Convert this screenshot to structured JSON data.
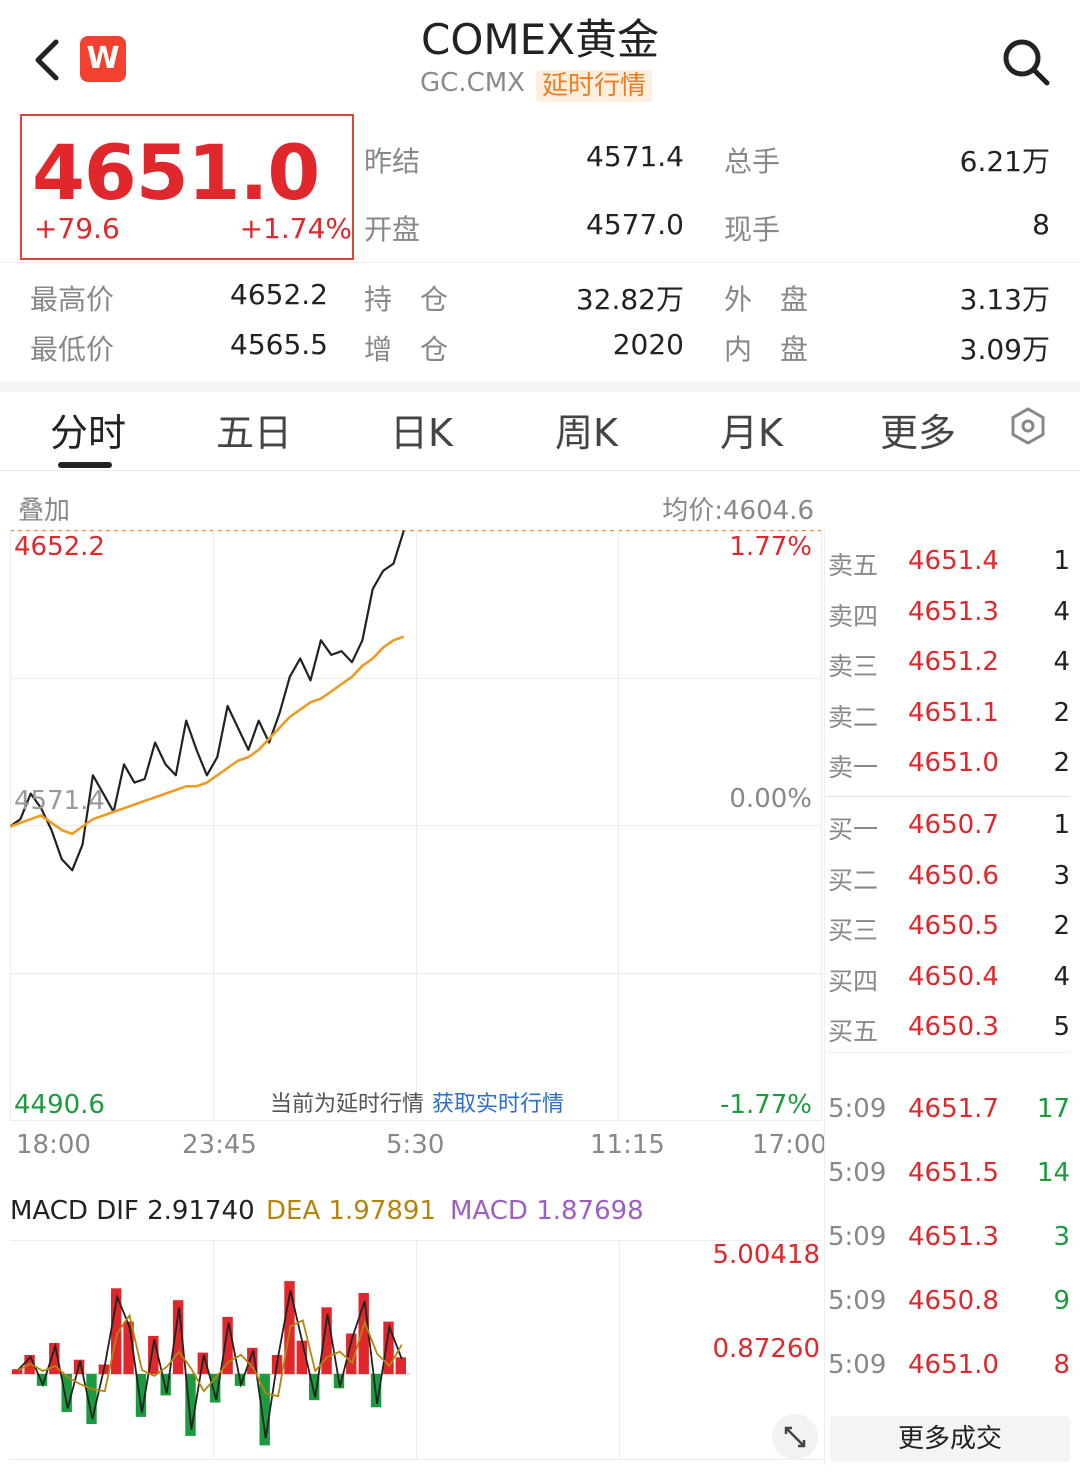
{
  "header": {
    "brand_letter": "W",
    "title": "COMEX黄金",
    "symbol": "GC.CMX",
    "delay_tag": "延时行情"
  },
  "quote": {
    "price": "4651.0",
    "change": "+79.6",
    "change_pct": "+1.74%",
    "rows": [
      [
        {
          "label": "昨结",
          "value": "4571.4"
        },
        {
          "label": "总手",
          "value": "6.21万"
        }
      ],
      [
        {
          "label": "开盘",
          "value": "4577.0"
        },
        {
          "label": "现手",
          "value": "8"
        }
      ],
      [
        {
          "label": "最高价",
          "value": "4652.2"
        },
        {
          "label": "持　仓",
          "value": "32.82万"
        },
        {
          "label": "外　盘",
          "value": "3.13万"
        }
      ],
      [
        {
          "label": "最低价",
          "value": "4565.5"
        },
        {
          "label": "增　仓",
          "value": "2020"
        },
        {
          "label": "内　盘",
          "value": "3.09万"
        }
      ]
    ]
  },
  "tabs": [
    "分时",
    "五日",
    "日K",
    "周K",
    "月K",
    "更多"
  ],
  "chart_header": {
    "overlay": "叠加",
    "avg_price": "均价:4604.6"
  },
  "chart_notice": {
    "text": "当前为延时行情",
    "link": "获取实时行情"
  },
  "chart_data": {
    "type": "line",
    "high_label": "4652.2",
    "mid_label": "4571.4",
    "low_label": "4490.6",
    "pct_high": "1.77%",
    "pct_mid": "0.00%",
    "pct_low": "-1.77%",
    "time_labels": [
      "18:00",
      "23:45",
      "5:30",
      "11:15",
      "17:00"
    ],
    "ylim": [
      4490.6,
      4652.2
    ],
    "series": [
      {
        "values": [
          4571,
          4573,
          4580,
          4576,
          4570,
          4562,
          4559,
          4566,
          4585,
          4580,
          4575,
          4588,
          4583,
          4584,
          4594,
          4588,
          4585,
          4600,
          4592,
          4585,
          4590,
          4604,
          4598,
          4592,
          4600,
          4594,
          4602,
          4612,
          4617,
          4611,
          4622,
          4618,
          4619,
          4616,
          4622,
          4636,
          4641,
          4643,
          4652
        ]
      },
      {
        "values": [
          4571,
          4572,
          4573,
          4574,
          4572,
          4570,
          4569,
          4571,
          4573,
          4574,
          4575,
          4576,
          4577,
          4578,
          4579,
          4580,
          4581,
          4582,
          4582,
          4583,
          4585,
          4587,
          4589,
          4590,
          4592,
          4595,
          4598,
          4601,
          4603,
          4605,
          4606,
          4608,
          4610,
          4612,
          4615,
          4617,
          4620,
          4622,
          4623
        ]
      }
    ]
  },
  "macd": {
    "dif_label": "MACD DIF 2.91740",
    "dea_label": "DEA 1.97891",
    "macd_label": "MACD 1.87698",
    "top_value": "5.00418",
    "mid_value": "0.87260",
    "values": [
      0.2,
      0.8,
      -0.5,
      1.3,
      -1.6,
      0.6,
      -2.1,
      0.4,
      3.6,
      2.2,
      -1.8,
      1.6,
      -0.9,
      3.1,
      -2.6,
      0.9,
      -1.2,
      2.4,
      -0.5,
      1.1,
      -3.0,
      0.8,
      3.9,
      1.4,
      -1.1,
      2.8,
      -0.6,
      1.7,
      3.4,
      -1.4,
      2.2,
      0.7
    ]
  },
  "orderbook": {
    "asks": [
      {
        "label": "卖五",
        "price": "4651.4",
        "vol": "1"
      },
      {
        "label": "卖四",
        "price": "4651.3",
        "vol": "4"
      },
      {
        "label": "卖三",
        "price": "4651.2",
        "vol": "4"
      },
      {
        "label": "卖二",
        "price": "4651.1",
        "vol": "2"
      },
      {
        "label": "卖一",
        "price": "4651.0",
        "vol": "2"
      }
    ],
    "bids": [
      {
        "label": "买一",
        "price": "4650.7",
        "vol": "1"
      },
      {
        "label": "买二",
        "price": "4650.6",
        "vol": "3"
      },
      {
        "label": "买三",
        "price": "4650.5",
        "vol": "2"
      },
      {
        "label": "买四",
        "price": "4650.4",
        "vol": "4"
      },
      {
        "label": "买五",
        "price": "4650.3",
        "vol": "5"
      }
    ],
    "trades": [
      {
        "time": "5:09",
        "price": "4651.7",
        "vol": "17",
        "color": "#1a9c3e"
      },
      {
        "time": "5:09",
        "price": "4651.5",
        "vol": "14",
        "color": "#1a9c3e"
      },
      {
        "time": "5:09",
        "price": "4651.3",
        "vol": "3",
        "color": "#1a9c3e"
      },
      {
        "time": "5:09",
        "price": "4650.8",
        "vol": "9",
        "color": "#1a9c3e"
      },
      {
        "time": "5:09",
        "price": "4651.0",
        "vol": "8",
        "color": "#e0272b"
      }
    ],
    "more_trades": "更多成交"
  },
  "colors": {
    "up": "#e0272b",
    "down": "#1a9c3e",
    "avg_line": "#ef9a22",
    "price_line": "#222222"
  }
}
